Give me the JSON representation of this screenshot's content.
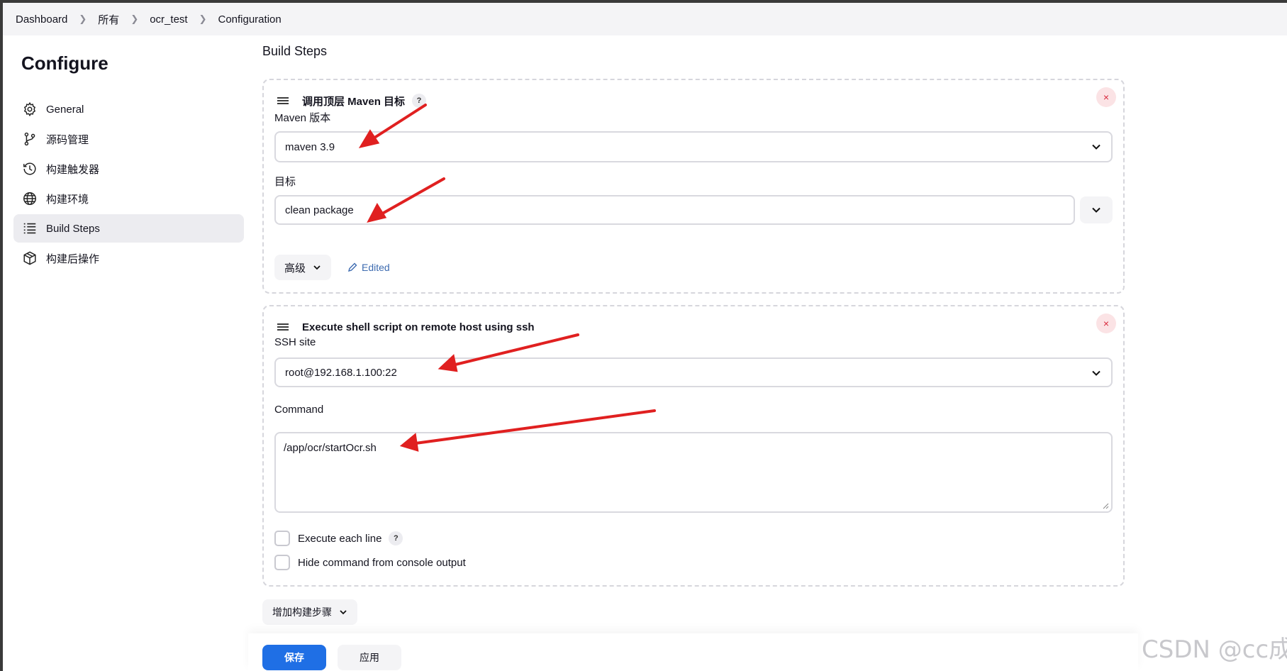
{
  "breadcrumb": [
    "Dashboard",
    "所有",
    "ocr_test",
    "Configuration"
  ],
  "sidebar": {
    "title": "Configure",
    "items": [
      {
        "label": "General",
        "icon": "gear-icon"
      },
      {
        "label": "源码管理",
        "icon": "branch-icon"
      },
      {
        "label": "构建触发器",
        "icon": "clock-icon"
      },
      {
        "label": "构建环境",
        "icon": "globe-icon"
      },
      {
        "label": "Build Steps",
        "icon": "list-icon",
        "active": true
      },
      {
        "label": "构建后操作",
        "icon": "package-icon"
      }
    ]
  },
  "main": {
    "section_title": "Build Steps",
    "maven_step": {
      "title": "调用顶层 Maven 目标",
      "help": "?",
      "close": "×",
      "version_label": "Maven 版本",
      "version_value": "maven 3.9",
      "goals_label": "目标",
      "goals_value": "clean package",
      "advanced_label": "高级",
      "edited_label": "Edited"
    },
    "ssh_step": {
      "title": "Execute shell script on remote host using ssh",
      "close": "×",
      "site_label": "SSH site",
      "site_value": "root@192.168.1.100:22",
      "command_label": "Command",
      "command_value": "/app/ocr/startOcr.sh",
      "execute_each_line": {
        "label": "Execute each line",
        "checked": false,
        "help": "?"
      },
      "hide_command": {
        "label": "Hide command from console output",
        "checked": false
      }
    },
    "add_step_label": "增加构建步骤"
  },
  "footer": {
    "save_label": "保存",
    "apply_label": "应用"
  },
  "watermark": "CSDN @cc成",
  "colors": {
    "primary": "#1f6fe5",
    "annotation_arrow": "#e02020",
    "danger": "#d8283c",
    "link": "#3d6bb0"
  }
}
